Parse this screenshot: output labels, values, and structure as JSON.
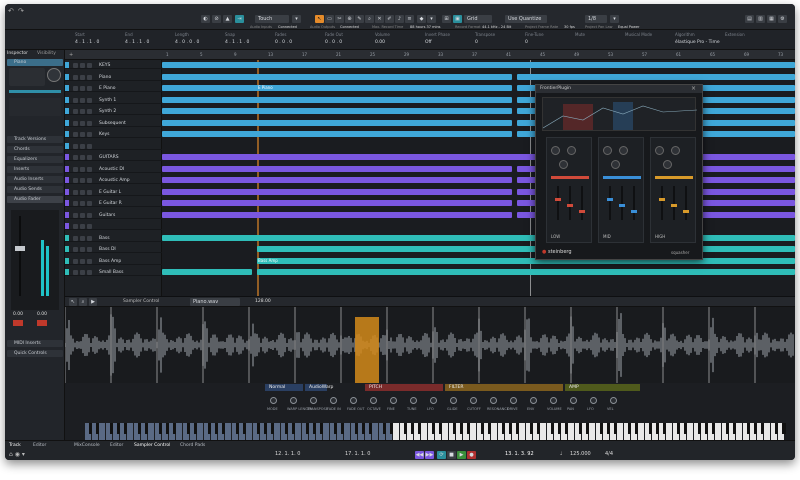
{
  "toolbar": {
    "touch_mode": "Touch",
    "grid_type": "Grid",
    "quantize_mode": "Use Quantize",
    "quantize_value": "1/8",
    "accent": "#e58b2a"
  },
  "info_line": [
    {
      "head": "Start",
      "value": "4 . 1 . 1 . 0"
    },
    {
      "head": "End",
      "value": "4 . 1 . 1 . 0"
    },
    {
      "head": "Length",
      "value": "4 . 0 . 0 . 0"
    },
    {
      "head": "Snap",
      "value": "4 . 1 . 1 . 0"
    },
    {
      "head": "Fades",
      "value": "0 . 0 . 0"
    },
    {
      "head": "Fade Out",
      "value": "0 . 0 . 0"
    },
    {
      "head": "Volume",
      "value": "0.00"
    },
    {
      "head": "Invert Phase",
      "value": "Off"
    },
    {
      "head": "Transpose",
      "value": "0"
    },
    {
      "head": "Fine-Tune",
      "value": "0"
    },
    {
      "head": "Mute",
      "value": ""
    },
    {
      "head": "Musical Mode",
      "value": ""
    },
    {
      "head": "Algorithm",
      "value": "élastique Pro - Time"
    },
    {
      "head": "Extension",
      "value": ""
    }
  ],
  "status_strip": [
    {
      "label": "Audio Inputs",
      "value": "Connected"
    },
    {
      "label": "Audio Outputs",
      "value": "Connected"
    },
    {
      "label": "Max. Record Time",
      "value": "88 hours 37 mins"
    },
    {
      "label": "Record Format",
      "value": "44.1 kHz - 24 Bit"
    },
    {
      "label": "Project Frame Rate",
      "value": "30 fps"
    },
    {
      "label": "Project Pan Law",
      "value": "Equal Power"
    }
  ],
  "inspector": {
    "tabs": [
      "Inspector",
      "Visibility"
    ],
    "track": "Piano",
    "sections": [
      "Track Versions",
      "Chords",
      "Equalizers",
      "Inserts",
      "Audio Inserts",
      "Audio Sends",
      "Audio Fader"
    ],
    "sections_bottom": [
      "MIDI Inserts",
      "Quick Controls"
    ],
    "fader_value": "0.00",
    "pan_value": "0.00"
  },
  "tracks": [
    {
      "name": "KEYS",
      "color": "#3fa7d8"
    },
    {
      "name": "Piano",
      "color": "#3fa7d8"
    },
    {
      "name": "E Piano",
      "color": "#3fa7d8"
    },
    {
      "name": "Synth 1",
      "color": "#3fa7d8"
    },
    {
      "name": "Synth 2",
      "color": "#3fa7d8"
    },
    {
      "name": "Subsequent",
      "color": "#3fa7d8"
    },
    {
      "name": "Keys",
      "color": "#3fa7d8"
    },
    {
      "name": "",
      "color": "#3fa7d8"
    },
    {
      "name": "GUITARS",
      "color": "#7a57e0"
    },
    {
      "name": "Acoustic DI",
      "color": "#7a57e0"
    },
    {
      "name": "Acoustic Amp",
      "color": "#7a57e0"
    },
    {
      "name": "E Guitar L",
      "color": "#7a57e0"
    },
    {
      "name": "E Guitar R",
      "color": "#7a57e0"
    },
    {
      "name": "Guitars",
      "color": "#7a57e0"
    },
    {
      "name": "",
      "color": "#7a57e0"
    },
    {
      "name": "Bass",
      "color": "#2fbdb8"
    },
    {
      "name": "Bass DI",
      "color": "#2fbdb8"
    },
    {
      "name": "Bass Amp",
      "color": "#2fbdb8"
    },
    {
      "name": "Small Bass",
      "color": "#2fbdb8"
    }
  ],
  "ruler_marks": [
    "1",
    "5",
    "9",
    "13",
    "17",
    "21",
    "25",
    "29",
    "33",
    "37",
    "41",
    "45",
    "49",
    "53",
    "57",
    "61",
    "65",
    "69",
    "73"
  ],
  "clip_labels": {
    "epiano": "E Piano",
    "bass": "Bass Amp"
  },
  "plugin": {
    "title": "FrontierPlugin",
    "brand": "steinberg",
    "product": "squasher",
    "band_labels": [
      "LOW",
      "MID",
      "HIGH"
    ],
    "colors": [
      "#d04a3a",
      "#3a8fd8",
      "#d89a2a"
    ]
  },
  "lower_zone": {
    "title": "Sampler Control",
    "file": "Piano.wav",
    "time": "128.00",
    "sections": [
      {
        "name": "Normal",
        "color": "#2a3f62"
      },
      {
        "name": "AudioWarp",
        "color": "#2a3f62"
      },
      {
        "name": "PITCH",
        "color": "#7a2b2b"
      },
      {
        "name": "FILTER",
        "color": "#7a5a1e"
      },
      {
        "name": "AMP",
        "color": "#4f5a1c"
      }
    ],
    "knob_labels": [
      "MODE",
      "WARP LENGTH",
      "TRANSPOSE",
      "FADE IN",
      "FADE OUT",
      "OCTAVE",
      "FINE",
      "TUNE",
      "LFO",
      "GLIDE",
      "CUTOFF",
      "RESONANCE",
      "DRIVE",
      "ENV",
      "VOLUME",
      "PAN",
      "LFO",
      "VEL"
    ]
  },
  "bottom_tabs": [
    "Track",
    "Editor",
    "MixConsole",
    "Editor",
    "Sampler Control",
    "Chord Pads"
  ],
  "transport": {
    "left_locator": "12. 1. 1. 0",
    "right_locator": "17. 1. 1. 0",
    "position": "13. 1. 3. 92",
    "tempo": "125.000",
    "signature": "4/4"
  }
}
